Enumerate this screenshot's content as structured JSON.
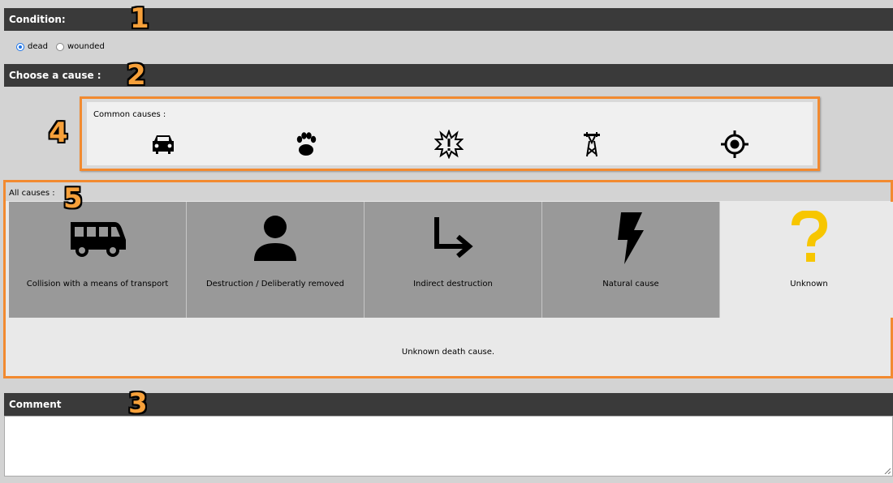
{
  "condition": {
    "title": "Condition:",
    "options": [
      {
        "label": "dead",
        "checked": true
      },
      {
        "label": "wounded",
        "checked": false
      }
    ]
  },
  "cause": {
    "title": "Choose a cause :",
    "common": {
      "label": "Common causes :",
      "icons": [
        "car-icon",
        "paw-icon",
        "explosion-icon",
        "power-pylon-icon",
        "crosshair-icon"
      ]
    },
    "all": {
      "label": "All causes :",
      "tiles": [
        {
          "label": "Collision with a means of transport",
          "icon": "van-icon"
        },
        {
          "label": "Destruction / Deliberatly removed",
          "icon": "person-icon"
        },
        {
          "label": "Indirect destruction",
          "icon": "arrow-down-right-icon"
        },
        {
          "label": "Natural cause",
          "icon": "lightning-icon"
        },
        {
          "label": "Unknown",
          "icon": "question-icon"
        }
      ],
      "selected_index": 4,
      "description": "Unknown death cause."
    }
  },
  "comment": {
    "title": "Comment",
    "value": ""
  },
  "markers": [
    "1",
    "2",
    "3",
    "4",
    "5"
  ],
  "colors": {
    "header_bg": "#3a3a3a",
    "highlight_border": "#f28a30",
    "tile_bg": "#999999",
    "question_yellow": "#f7c600",
    "radio_blue": "#1a73e8"
  }
}
